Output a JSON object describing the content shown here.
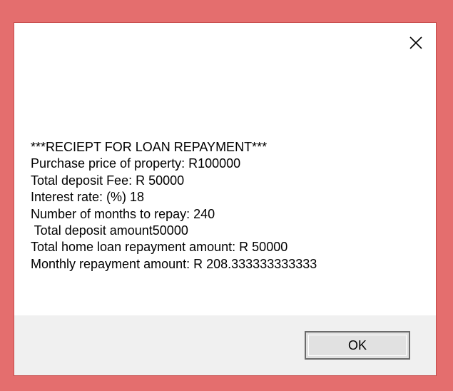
{
  "dialog": {
    "close_icon": "close-icon",
    "message_lines": [
      "***RECIEPT FOR LOAN REPAYMENT***",
      "Purchase price of property: R100000",
      "Total deposit Fee: R 50000",
      "Interest rate: (%) 18",
      "Number of months to repay: 240",
      " Total deposit amount50000",
      "Total home loan repayment amount: R 50000",
      "Monthly repayment amount: R 208.333333333333"
    ],
    "ok_label": "OK"
  },
  "colors": {
    "background": "#e46e6e",
    "dialog": "#ffffff",
    "footer": "#f0f0f0",
    "button": "#e1e1e1"
  }
}
